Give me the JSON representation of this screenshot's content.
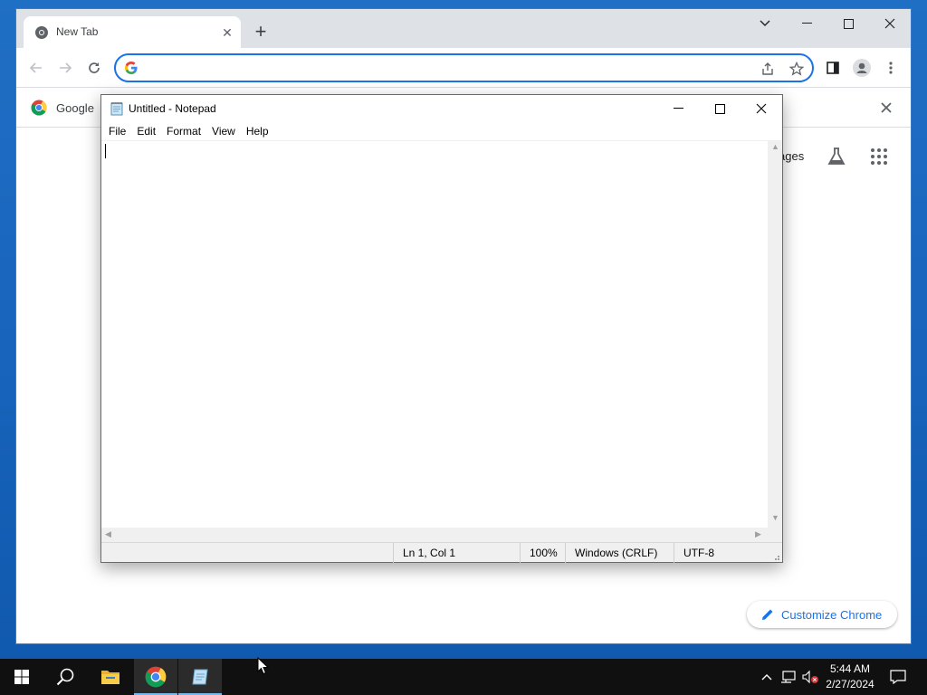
{
  "chrome": {
    "tab_title": "New Tab",
    "omnibox_value": "",
    "omnibox_placeholder": "",
    "bookmark_label": "Google",
    "images_link": "ages",
    "customize_label": "Customize Chrome"
  },
  "notepad": {
    "title": "Untitled - Notepad",
    "menu": [
      "File",
      "Edit",
      "Format",
      "View",
      "Help"
    ],
    "content": "",
    "status": {
      "position": "Ln 1, Col 1",
      "zoom": "100%",
      "line_ending": "Windows (CRLF)",
      "encoding": "UTF-8"
    }
  },
  "taskbar": {
    "time": "5:44 AM",
    "date": "2/27/2024",
    "icons": [
      "start-icon",
      "search-icon",
      "file-explorer-icon",
      "chrome-icon",
      "notepad-icon"
    ]
  },
  "colors": {
    "desktop": "#1a66bf",
    "accent": "#1a73e8",
    "tabstrip": "#dee1e6",
    "taskbar": "#101010"
  }
}
